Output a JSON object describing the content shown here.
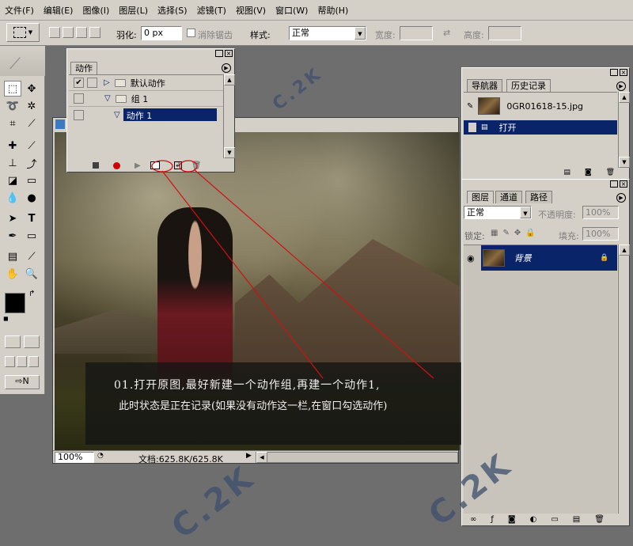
{
  "menu": [
    "文件(F)",
    "编辑(E)",
    "图像(I)",
    "图层(L)",
    "选择(S)",
    "滤镜(T)",
    "视图(V)",
    "窗口(W)",
    "帮助(H)"
  ],
  "options": {
    "feather_label": "羽化:",
    "feather_value": "0 px",
    "antialias_label": "消除锯齿",
    "style_label": "样式:",
    "style_value": "正常",
    "width_label": "宽度:",
    "height_label": "高度:"
  },
  "actions_panel": {
    "tab": "动作",
    "rows": [
      {
        "label": "默认动作",
        "checked": true
      },
      {
        "label": "组 1",
        "checked": false
      },
      {
        "label": "动作 1",
        "checked": false,
        "selected": true
      }
    ]
  },
  "history_panel": {
    "tabs": [
      "导航器",
      "历史记录"
    ],
    "snapshot": "0GR01618-15.jpg",
    "state": "打开"
  },
  "layers_panel": {
    "tabs": [
      "图层",
      "通道",
      "路径"
    ],
    "blend_mode": "正常",
    "opacity_label": "不透明度:",
    "opacity_value": "100%",
    "lock_label": "锁定:",
    "fill_label": "填充:",
    "fill_value": "100%",
    "layer_name": "背景"
  },
  "document": {
    "zoom": "100%",
    "status": "文档:625.8K/625.8K"
  },
  "caption": {
    "line1": "01.打开原图,最好新建一个动作组,再建一个动作1,",
    "line2": "此时状态是正在记录(如果没有动作这一栏,在窗口勾选动作)"
  },
  "watermark": "C.2K",
  "colors": {
    "selection": "#0a246a",
    "record": "#d00000",
    "callout": "#d01010"
  }
}
